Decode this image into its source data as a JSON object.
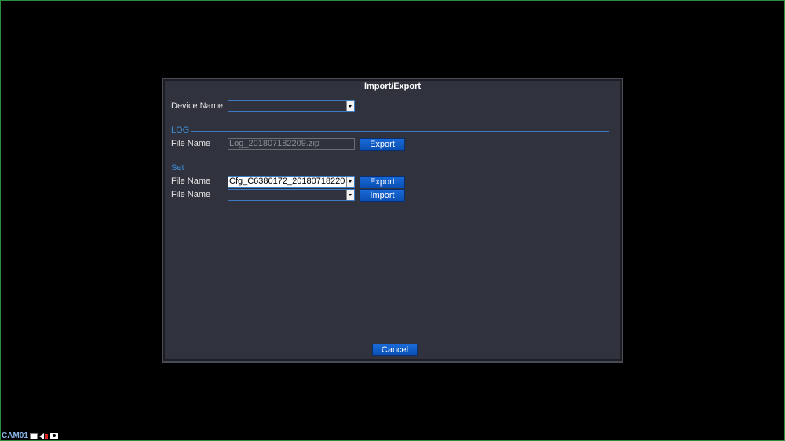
{
  "dialog": {
    "title": "Import/Export",
    "device_name_label": "Device Name",
    "device_name_value": "",
    "log": {
      "section_label": "LOG",
      "file_name_label": "File Name",
      "file_name_value": "Log_201807182209.zip",
      "export_label": "Export"
    },
    "set": {
      "section_label": "Set",
      "export_row": {
        "file_name_label": "File Name",
        "file_name_value": "Cfg_C6380172_20180718220",
        "export_label": "Export"
      },
      "import_row": {
        "file_name_label": "File Name",
        "file_name_value": "",
        "import_label": "Import"
      }
    },
    "cancel_label": "Cancel"
  },
  "status_bar": {
    "camera_name": "CAM01"
  },
  "colors": {
    "dialog_bg": "#30323d",
    "accent": "#3d7ac2",
    "button": "#0a4fb3",
    "frame": "#2a8f3a"
  }
}
